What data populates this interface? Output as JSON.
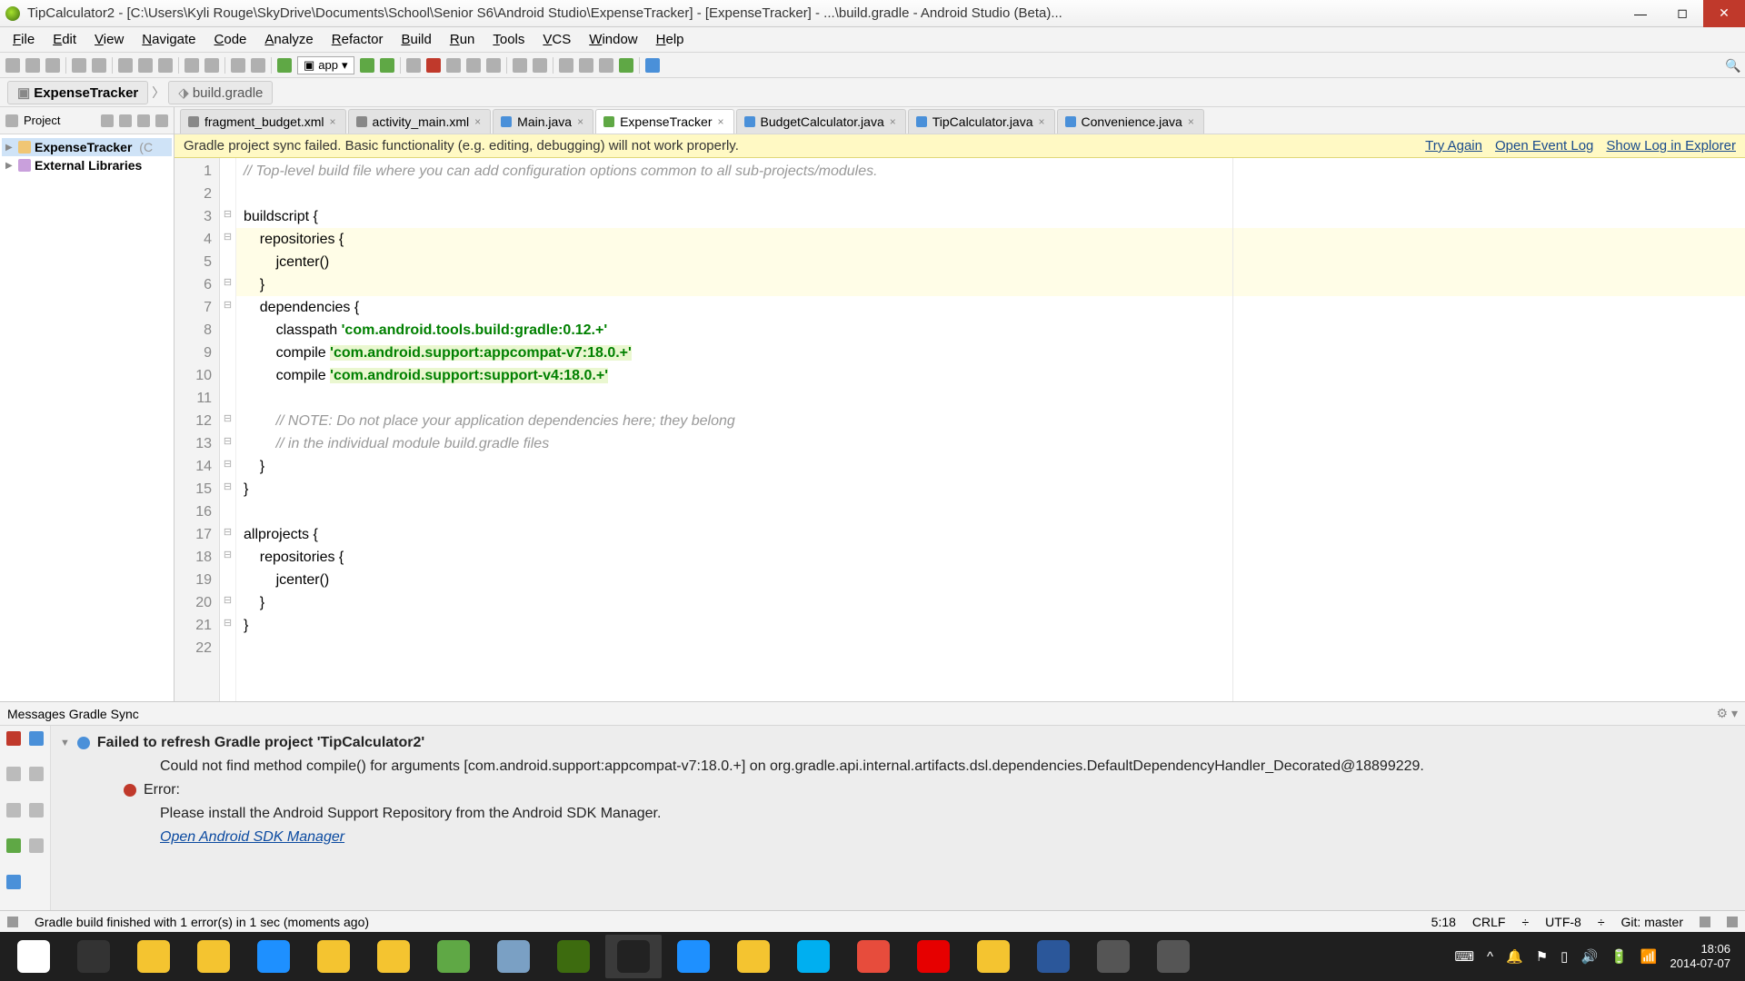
{
  "window": {
    "title": "TipCalculator2 - [C:\\Users\\Kyli Rouge\\SkyDrive\\Documents\\School\\Senior S6\\Android Studio\\ExpenseTracker] - [ExpenseTracker] - ...\\build.gradle - Android Studio (Beta)..."
  },
  "menu": [
    "File",
    "Edit",
    "View",
    "Navigate",
    "Code",
    "Analyze",
    "Refactor",
    "Build",
    "Run",
    "Tools",
    "VCS",
    "Window",
    "Help"
  ],
  "runConfig": "app",
  "breadcrumb": {
    "root": "ExpenseTracker",
    "file": "build.gradle"
  },
  "sidebar": {
    "headLabel": "Project",
    "items": [
      {
        "label": "ExpenseTracker",
        "kind": "dir",
        "sel": true,
        "suffix": "(C"
      },
      {
        "label": "External Libraries",
        "kind": "lib"
      }
    ]
  },
  "tabs": [
    {
      "label": "fragment_budget.xml",
      "kind": "xml"
    },
    {
      "label": "activity_main.xml",
      "kind": "xml"
    },
    {
      "label": "Main.java",
      "kind": "java"
    },
    {
      "label": "ExpenseTracker",
      "kind": "gradle",
      "active": true
    },
    {
      "label": "BudgetCalculator.java",
      "kind": "java"
    },
    {
      "label": "TipCalculator.java",
      "kind": "java"
    },
    {
      "label": "Convenience.java",
      "kind": "java"
    }
  ],
  "banner": {
    "msg": "Gradle project sync failed. Basic functionality (e.g. editing, debugging) will not work properly.",
    "links": [
      "Try Again",
      "Open Event Log",
      "Show Log in Explorer"
    ]
  },
  "code": {
    "lines": [
      {
        "n": 1,
        "fold": "",
        "html": "<span class='cmt'>// Top-level build file where you can add configuration options common to all sub-projects/modules.</span>"
      },
      {
        "n": 2,
        "fold": "",
        "html": ""
      },
      {
        "n": 3,
        "fold": "⊟",
        "html": "buildscript {"
      },
      {
        "n": 4,
        "fold": "⊟",
        "html": "    repositories {",
        "hl": true
      },
      {
        "n": 5,
        "fold": "",
        "html": "        jcenter()",
        "hl": true
      },
      {
        "n": 6,
        "fold": "⊟",
        "html": "    }",
        "hl": true
      },
      {
        "n": 7,
        "fold": "⊟",
        "html": "    dependencies {"
      },
      {
        "n": 8,
        "fold": "",
        "html": "        classpath <span class='str'>'com.android.tools.build:gradle:0.12.+'</span>"
      },
      {
        "n": 9,
        "fold": "",
        "html": "        compile <span class='str hl-green'>'com.android.support:appcompat-v7:18.0.+'</span>"
      },
      {
        "n": 10,
        "fold": "",
        "html": "        compile <span class='str hl-green'>'com.android.support:support-v4:18.0.+'</span>"
      },
      {
        "n": 11,
        "fold": "",
        "html": ""
      },
      {
        "n": 12,
        "fold": "⊟",
        "html": "        <span class='cmt'>// NOTE: Do not place your application dependencies here; they belong</span>"
      },
      {
        "n": 13,
        "fold": "⊟",
        "html": "        <span class='cmt'>// in the individual module build.gradle files</span>"
      },
      {
        "n": 14,
        "fold": "⊟",
        "html": "    }"
      },
      {
        "n": 15,
        "fold": "⊟",
        "html": "}"
      },
      {
        "n": 16,
        "fold": "",
        "html": ""
      },
      {
        "n": 17,
        "fold": "⊟",
        "html": "allprojects {"
      },
      {
        "n": 18,
        "fold": "⊟",
        "html": "    repositories {"
      },
      {
        "n": 19,
        "fold": "",
        "html": "        jcenter()"
      },
      {
        "n": 20,
        "fold": "⊟",
        "html": "    }"
      },
      {
        "n": 21,
        "fold": "⊟",
        "html": "}"
      },
      {
        "n": 22,
        "fold": "",
        "html": ""
      }
    ]
  },
  "messages": {
    "tabLabel": "Messages Gradle Sync",
    "title": "Failed to refresh Gradle project 'TipCalculator2'",
    "line1": "Could not find method compile() for arguments [com.android.support:appcompat-v7:18.0.+] on org.gradle.api.internal.artifacts.dsl.dependencies.DefaultDependencyHandler_Decorated@18899229.",
    "errorLabel": "Error:",
    "line2": "Please install the Android Support Repository from the Android SDK Manager.",
    "link": "Open Android SDK Manager"
  },
  "status": {
    "left": "Gradle build finished with 1 error(s) in 1 sec (moments ago)",
    "pos": "5:18",
    "eol": "CRLF",
    "enc": "UTF-8",
    "git": "Git: master"
  },
  "tray": {
    "time": "18:06",
    "date": "2014-07-07"
  },
  "taskbarApps": [
    "#333",
    "#f4c430",
    "#f4c430",
    "#1e90ff",
    "#f4c430",
    "#f4c430",
    "#5fa845",
    "#7aa0c4",
    "#3d6b0f",
    "#222",
    "#1e90ff",
    "#f4c430",
    "#00aff0",
    "#e74c3c",
    "#e60000",
    "#f4c430",
    "#2b579a",
    "#555",
    "#555"
  ]
}
